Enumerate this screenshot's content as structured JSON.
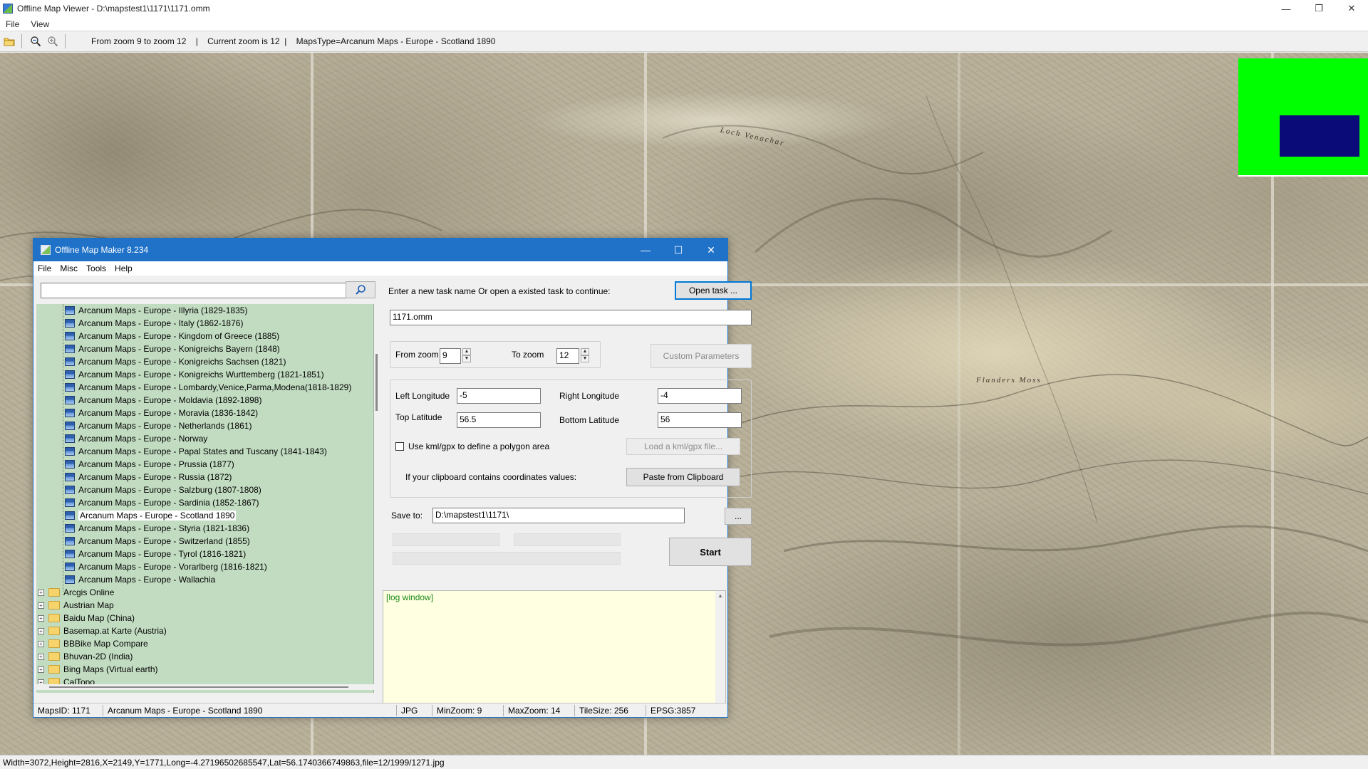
{
  "viewer": {
    "title": "Offline Map Viewer - D:\\mapstest1\\1171\\1171.omm",
    "menu": [
      "File",
      "View"
    ],
    "toolbar": {
      "info": "From zoom 9 to zoom 12    |    Current zoom is 12  |    MapsType=Arcanum Maps - Europe - Scotland 1890"
    },
    "map_labels": {
      "loch": "Loch   Venachar",
      "moss": "Flanders Moss"
    },
    "status": "Width=3072,Height=2816,X=2149,Y=1771,Long=-4.27196502685547,Lat=56.1740366749863,file=12/1999/1271.jpg",
    "window_controls": {
      "minimize": "—",
      "restore": "❐",
      "close": "✕"
    }
  },
  "maker": {
    "title": "Offline Map Maker 8.234",
    "menu": [
      "File",
      "Misc",
      "Tools",
      "Help"
    ],
    "window_controls": {
      "minimize": "—",
      "maximize": "☐",
      "close": "✕"
    },
    "search": {
      "value": ""
    },
    "tree": {
      "map_items": [
        "Arcanum Maps - Europe - Illyria (1829-1835)",
        "Arcanum Maps - Europe - Italy (1862-1876)",
        "Arcanum Maps - Europe - Kingdom of Greece (1885)",
        "Arcanum Maps - Europe - Konigreichs Bayern (1848)",
        "Arcanum Maps - Europe - Konigreichs Sachsen (1821)",
        "Arcanum Maps - Europe - Konigreichs Wurttemberg (1821-1851)",
        "Arcanum Maps - Europe - Lombardy,Venice,Parma,Modena(1818-1829)",
        "Arcanum Maps - Europe - Moldavia (1892-1898)",
        "Arcanum Maps - Europe - Moravia (1836-1842)",
        "Arcanum Maps - Europe - Netherlands (1861)",
        "Arcanum Maps - Europe - Norway",
        "Arcanum Maps - Europe - Papal States and Tuscany (1841-1843)",
        "Arcanum Maps - Europe - Prussia (1877)",
        "Arcanum Maps - Europe - Russia (1872)",
        "Arcanum Maps - Europe - Salzburg (1807-1808)",
        "Arcanum Maps - Europe - Sardinia (1852-1867)",
        "Arcanum Maps - Europe - Scotland 1890",
        "Arcanum Maps - Europe - Styria (1821-1836)",
        "Arcanum Maps - Europe - Switzerland (1855)",
        "Arcanum Maps - Europe - Tyrol (1816-1821)",
        "Arcanum Maps - Europe - Vorarlberg (1816-1821)",
        "Arcanum Maps - Europe - Wallachia"
      ],
      "selected": "Arcanum Maps - Europe - Scotland 1890",
      "folders": [
        "Arcgis Online",
        "Austrian Map",
        "Baidu Map (China)",
        "Basemap.at Karte (Austria)",
        "BBBike Map Compare",
        "Bhuvan-2D (India)",
        "Bing Maps (Virtual earth)",
        "CalTopo"
      ]
    },
    "task": {
      "prompt": "Enter a new task name Or open a existed task to continue:",
      "open_button": "Open task ...",
      "name_value": "1171.omm"
    },
    "zoom": {
      "from_label": "From zoom",
      "from_value": "9",
      "to_label": "To zoom",
      "to_value": "12",
      "custom_button": "Custom Parameters"
    },
    "coords": {
      "left_lon_label": "Left Longitude",
      "left_lon_value": "-5",
      "right_lon_label": "Right Longitude",
      "right_lon_value": "-4",
      "top_lat_label": "Top Latitude",
      "top_lat_value": "56.5",
      "bottom_lat_label": "Bottom Latitude",
      "bottom_lat_value": "56",
      "kml_checkbox_label": "Use kml/gpx to define a polygon area",
      "kml_checked": false,
      "kml_button": "Load a kml/gpx file...",
      "clipboard_label": "If your clipboard contains coordinates values:",
      "clipboard_button": "Paste from Clipboard"
    },
    "save": {
      "label": "Save to:",
      "value": "D:\\mapstest1\\1171\\",
      "browse_button": "...",
      "start_button": "Start"
    },
    "log": {
      "text": "[log window]"
    },
    "statusbar": {
      "maps_id": "MapsID: 1171",
      "map_name": "Arcanum Maps - Europe - Scotland 1890",
      "format": "JPG",
      "min_zoom": "MinZoom: 9",
      "max_zoom": "MaxZoom: 14",
      "tile_size": "TileSize: 256",
      "epsg": "EPSG:3857"
    }
  },
  "colors": {
    "minimap_bg": "#00ff00",
    "minimap_viewport": "#0a0a78",
    "tree_bg": "#c2dcc2",
    "titlebar_accent": "#1f72c8",
    "log_bg": "#ffffe1",
    "log_text": "#1a8a1a"
  }
}
